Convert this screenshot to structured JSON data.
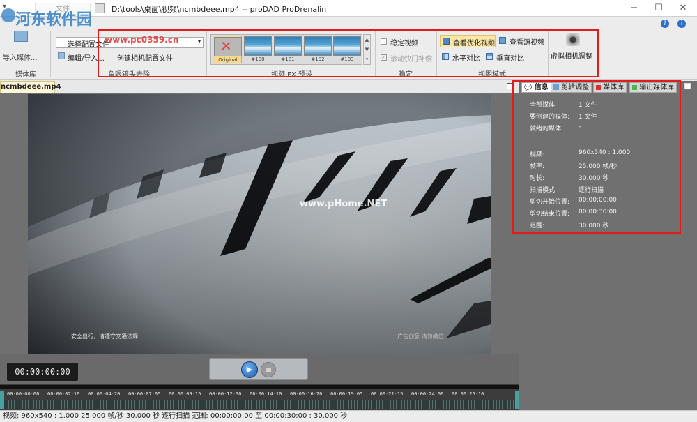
{
  "window": {
    "title": "D:\\tools\\桌面\\视频\\ncmbdeee.mp4 -- proDAD ProDrenalin",
    "minimize": "−",
    "maximize": "☐",
    "close": "✕"
  },
  "ribbon": {
    "file_tab": "文件",
    "import_media": "导入媒体...",
    "media_library_group": "媒体库",
    "select_profile": "选择配置文件",
    "edit_import": "编辑/导入...",
    "create_camera_profile": "创建相机配置文件",
    "fisheye_group": "鱼眼镜头去除",
    "presets": [
      {
        "label": "Original"
      },
      {
        "label": "#100"
      },
      {
        "label": "#101"
      },
      {
        "label": "#102"
      },
      {
        "label": "#103"
      }
    ],
    "video_fx_group": "视频 FX 预设",
    "stabilize_video": "稳定视频",
    "rolling_shutter": "滚动快门补偿",
    "stabilize_group": "稳定",
    "view_optimized": "查看优化视频",
    "view_source": "查看源视频",
    "horizontal_compare": "水平对比",
    "vertical_compare": "垂直对比",
    "view_mode_group": "视图模式",
    "virtual_camera": "虚拟相机调整"
  },
  "watermark": {
    "logo": "河东软件园",
    "url": "www.pc0359.cn"
  },
  "doc_tab": "ncmbdeee.mp4",
  "video": {
    "caption_left": "安全出行，请遵守交通法规",
    "caption_right": "广告创意 请勿模仿",
    "watermark": "www.pHome.NET"
  },
  "player": {
    "timecode": "00:00:00:00"
  },
  "timeline": {
    "ticks": [
      "00:00:00:00",
      "00:00:02:10",
      "00:00:04:20",
      "00:00:07:05",
      "00:00:09:15",
      "00:00:12:00",
      "00:00:14:10",
      "00:00:16:20",
      "00:00:19:05",
      "00:00:21:15",
      "00:00:24:00",
      "00:00:26:10"
    ]
  },
  "right_panel": {
    "tabs": [
      {
        "label": "信息",
        "color": "#ffffff"
      },
      {
        "label": "剪辑调整",
        "color": "#6aa0d8"
      },
      {
        "label": "媒体库",
        "color": "#d93030"
      },
      {
        "label": "输出媒体库",
        "color": "#4fb34f"
      }
    ],
    "info": [
      {
        "key": "全部媒体:",
        "value": "1 文件"
      },
      {
        "key": "要创建的媒体:",
        "value": "1 文件"
      },
      {
        "key": "就绪的媒体:",
        "value": "-"
      },
      {
        "key": "",
        "value": ""
      },
      {
        "key": "视频:",
        "value": "960x540 : 1.000"
      },
      {
        "key": "帧率:",
        "value": "25.000 帧/秒"
      },
      {
        "key": "时长:",
        "value": "30.000 秒"
      },
      {
        "key": "扫描模式:",
        "value": "逐行扫描"
      },
      {
        "key": "剪切开始位置:",
        "value": "00:00:00:00"
      },
      {
        "key": "剪切结束位置:",
        "value": "00:00:30:00"
      },
      {
        "key": "范围:",
        "value": "30.000 秒"
      }
    ]
  },
  "status": "视频: 960x540 : 1.000  25.000 帧/秒  30.000 秒  逐行扫描  范围: 00:00:00:00 至 00:00:30:00 : 30.000 秒",
  "colors": {
    "highlight_box": "#e01c1c",
    "accent": "#3a86c9"
  }
}
